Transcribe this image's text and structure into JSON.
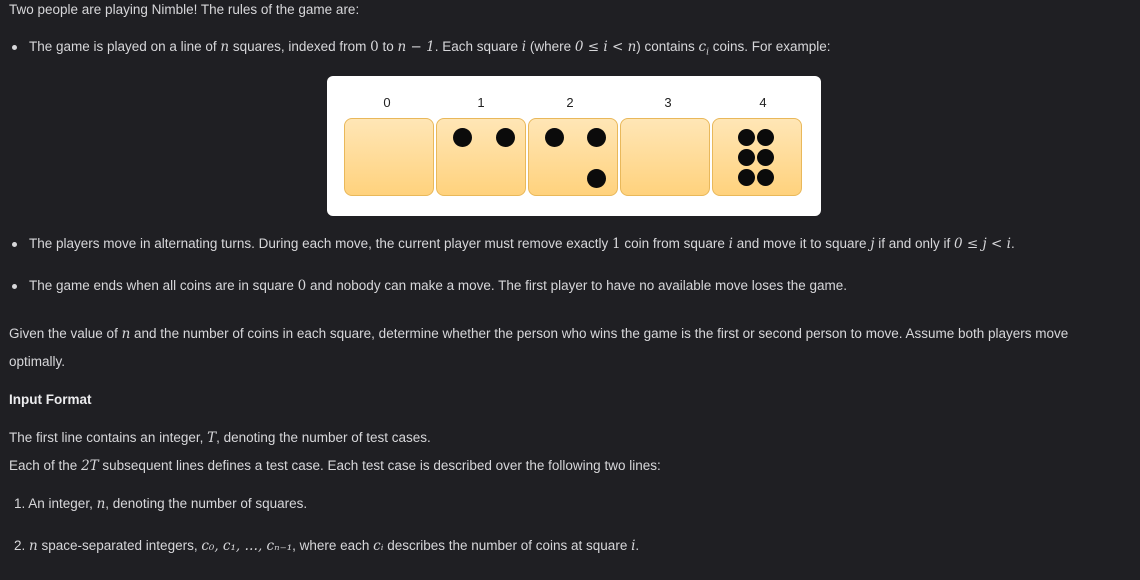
{
  "intro": "Two people are playing Nimble! The rules of the game are:",
  "rules": [
    {
      "before": "The game is played on a line of ",
      "v1": "n",
      "mid1": " squares, indexed from ",
      "v2": "0",
      "mid2": " to ",
      "v3": "n − 1",
      "mid3": ". Each square ",
      "v4": "i",
      "mid4": " (where ",
      "v5": "0 ≤ i < n",
      "mid5": ") contains ",
      "v6": "c",
      "v6sub": "i",
      "after": " coins. For example:"
    },
    {
      "before": "The players move in alternating turns. During each move, the current player must remove exactly ",
      "v1": "1",
      "mid1": " coin from square ",
      "v2": "i",
      "mid2": " and move it to square ",
      "v3": "j",
      "mid3": " if and only if ",
      "v4": "0 ≤ j < i",
      "after": "."
    },
    {
      "before": "The game ends when all coins are in square ",
      "v1": "0",
      "after": " and nobody can make a move. The first player to have no available move loses the game."
    }
  ],
  "figure": {
    "indices": [
      "0",
      "1",
      "2",
      "3",
      "4"
    ],
    "coins": [
      0,
      2,
      3,
      0,
      6
    ],
    "coin_color": "#0b0b0b",
    "square_fill": "#ffd98f"
  },
  "paragraph_line1": "Given the value of ",
  "paragraph_var": "n",
  "paragraph_line1_after": " and the number of coins in each square, determine whether the person who wins the game is the first or second person to move. Assume both players move",
  "paragraph_line2": "optimally.",
  "input_heading": "Input Format",
  "input_line1_before": "The first line contains an integer, ",
  "input_line1_var": "T",
  "input_line1_after": ", denoting the number of test cases.",
  "input_line2_before": "Each of the ",
  "input_line2_var": "2T",
  "input_line2_after": " subsequent lines defines a test case. Each test case is described over the following two lines:",
  "list": [
    {
      "num": "1.",
      "before": " An integer, ",
      "var": "n",
      "after": ", denoting the number of squares."
    },
    {
      "num": "2.",
      "var": "n",
      "mid": " space-separated integers, ",
      "seq": "c₀, c₁, …, cₙ₋₁",
      "mid2": ", where each ",
      "var2": "cᵢ",
      "mid3": " describes the number of coins at square ",
      "var3": "i",
      "after": "."
    }
  ]
}
